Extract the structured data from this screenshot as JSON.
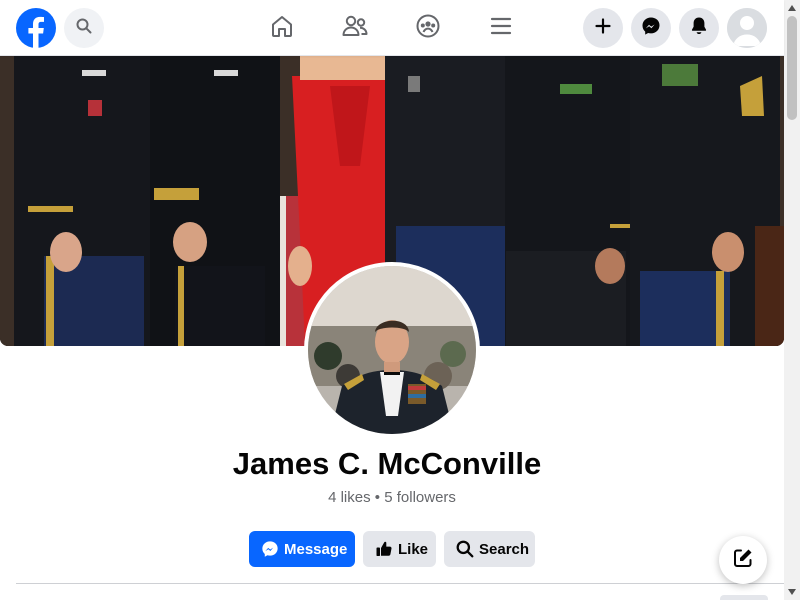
{
  "profile": {
    "name": "James C. McConville",
    "likes": "4 likes",
    "separator": "•",
    "followers": "5 followers"
  },
  "actions": {
    "message_label": "Message",
    "like_label": "Like",
    "search_label": "Search"
  },
  "colors": {
    "brand": "#0866ff",
    "secondary_button": "#e4e6eb",
    "muted_text": "#65676b"
  },
  "icons": {
    "logo": "facebook-logo-icon",
    "search": "search-icon",
    "home": "home-icon",
    "friends": "friends-icon",
    "groups": "groups-icon",
    "menu": "menu-icon",
    "create": "plus-icon",
    "messenger": "messenger-icon",
    "notifications": "bell-icon",
    "compose": "compose-icon"
  }
}
